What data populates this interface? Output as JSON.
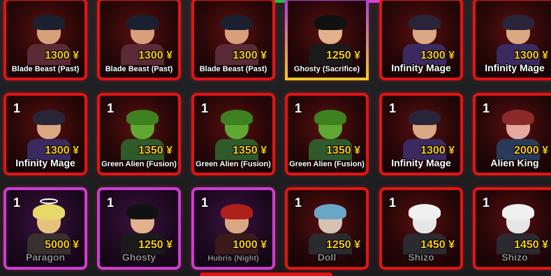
{
  "tabs": {
    "green": "",
    "pink": "",
    "red": ""
  },
  "cards": [
    {
      "count": "",
      "price": "1300 ¥",
      "name": "Blade Beast (Past)",
      "rarity": "red",
      "skin": "#d7a07a",
      "hair": "#1b2030",
      "outfit": "#5a2a36"
    },
    {
      "count": "",
      "price": "1300 ¥",
      "name": "Blade Beast (Past)",
      "rarity": "red",
      "skin": "#d7a07a",
      "hair": "#1b2030",
      "outfit": "#5a2a36"
    },
    {
      "count": "",
      "price": "1300 ¥",
      "name": "Blade Beast (Past)",
      "rarity": "red",
      "skin": "#d7a07a",
      "hair": "#1b2030",
      "outfit": "#5a2a36"
    },
    {
      "count": "",
      "price": "1250 ¥",
      "name": "Ghosty (Sacrifice)",
      "rarity": "secret",
      "skin": "#e2b08a",
      "hair": "#111111",
      "outfit": "#1a1a1a"
    },
    {
      "count": "",
      "price": "1300 ¥",
      "name": "Infinity Mage",
      "rarity": "red",
      "skin": "#d9a882",
      "hair": "#2a2438",
      "outfit": "#3a2a60",
      "big": true
    },
    {
      "count": "",
      "price": "1300 ¥",
      "name": "Infinity Mage",
      "rarity": "red",
      "skin": "#d9a882",
      "hair": "#2a2438",
      "outfit": "#3a2a60",
      "big": true
    },
    {
      "count": "1",
      "price": "1300 ¥",
      "name": "Infinity Mage",
      "rarity": "red",
      "skin": "#d9a882",
      "hair": "#2a2438",
      "outfit": "#3a2a60",
      "big": true
    },
    {
      "count": "1",
      "price": "1350 ¥",
      "name": "Green Alien (Fusion)",
      "rarity": "red",
      "skin": "#5fa832",
      "hair": "#3f8020",
      "outfit": "#2f5a2a"
    },
    {
      "count": "1",
      "price": "1350 ¥",
      "name": "Green Alien (Fusion)",
      "rarity": "red",
      "skin": "#5fa832",
      "hair": "#3f8020",
      "outfit": "#2f5a2a"
    },
    {
      "count": "1",
      "price": "1350 ¥",
      "name": "Green Alien (Fusion)",
      "rarity": "red",
      "skin": "#5fa832",
      "hair": "#3f8020",
      "outfit": "#2f5a2a"
    },
    {
      "count": "1",
      "price": "1300 ¥",
      "name": "Infinity Mage",
      "rarity": "red",
      "skin": "#d9a882",
      "hair": "#2a2438",
      "outfit": "#3a2a60",
      "big": true
    },
    {
      "count": "1",
      "price": "2000 ¥",
      "name": "Alien King",
      "rarity": "red",
      "skin": "#e4a8a0",
      "hair": "#8a2a2a",
      "outfit": "#2a3a5a",
      "big": true
    },
    {
      "count": "1",
      "price": "5000 ¥",
      "name": "Paragon",
      "rarity": "mythic",
      "skin": "#e7c27a",
      "hair": "#e8d86a",
      "outfit": "#3a3030",
      "big": true,
      "dim": true,
      "halo": true
    },
    {
      "count": "1",
      "price": "1250 ¥",
      "name": "Ghosty",
      "rarity": "mythic",
      "skin": "#e2b08a",
      "hair": "#111111",
      "outfit": "#1a1a1a",
      "big": true,
      "dim": true
    },
    {
      "count": "1",
      "price": "1000 ¥",
      "name": "Hubris (Night)",
      "rarity": "mythic",
      "skin": "#d9a882",
      "hair": "#b0201a",
      "outfit": "#3a1a1a",
      "dim": true
    },
    {
      "count": "1",
      "price": "1250 ¥",
      "name": "Doll",
      "rarity": "red",
      "skin": "#d6c2b2",
      "hair": "#6aa6c8",
      "outfit": "#2a2a30",
      "big": true,
      "dim": true
    },
    {
      "count": "1",
      "price": "1450 ¥",
      "name": "Shizo",
      "rarity": "red",
      "skin": "#e6e6e6",
      "hair": "#f0f0f0",
      "outfit": "#2a2a30",
      "big": true,
      "dim": true
    },
    {
      "count": "1",
      "price": "1450 ¥",
      "name": "Shizo",
      "rarity": "red",
      "skin": "#e6e6e6",
      "hair": "#f0f0f0",
      "outfit": "#2a2a30",
      "big": true,
      "dim": true
    }
  ]
}
